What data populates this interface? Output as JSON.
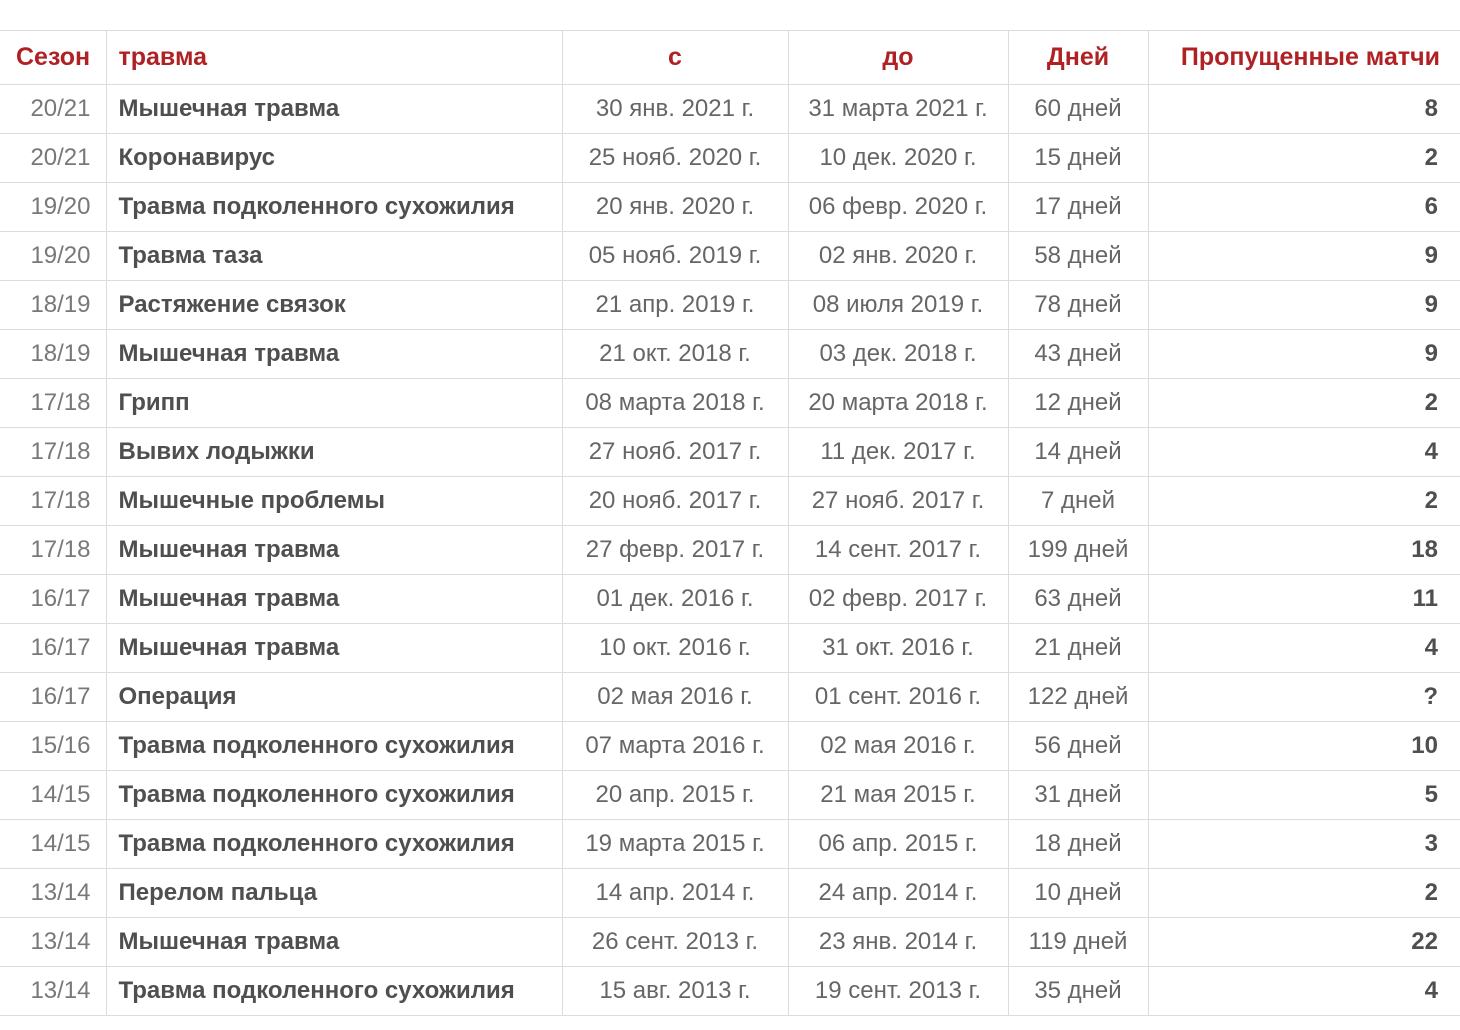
{
  "accent_color": "#b02124",
  "grid_color": "#dcdcdc",
  "chart_data": {
    "type": "table",
    "title": "",
    "columns": [
      "Сезон",
      "травма",
      "с",
      "до",
      "Дней",
      "Пропущенные матчи"
    ],
    "rows": [
      {
        "season": "20/21",
        "injury": "Мышечная травма",
        "from": "30 янв. 2021 г.",
        "to": "31 марта 2021 г.",
        "days": "60 дней",
        "missed": "8"
      },
      {
        "season": "20/21",
        "injury": "Коронавирус",
        "from": "25 нояб. 2020 г.",
        "to": "10 дек. 2020 г.",
        "days": "15 дней",
        "missed": "2"
      },
      {
        "season": "19/20",
        "injury": "Травма подколенного сухожилия",
        "from": "20 янв. 2020 г.",
        "to": "06 февр. 2020 г.",
        "days": "17 дней",
        "missed": "6"
      },
      {
        "season": "19/20",
        "injury": "Травма таза",
        "from": "05 нояб. 2019 г.",
        "to": "02 янв. 2020 г.",
        "days": "58 дней",
        "missed": "9"
      },
      {
        "season": "18/19",
        "injury": "Растяжение связок",
        "from": "21 апр. 2019 г.",
        "to": "08 июля 2019 г.",
        "days": "78 дней",
        "missed": "9"
      },
      {
        "season": "18/19",
        "injury": "Мышечная травма",
        "from": "21 окт. 2018 г.",
        "to": "03 дек. 2018 г.",
        "days": "43 дней",
        "missed": "9"
      },
      {
        "season": "17/18",
        "injury": "Грипп",
        "from": "08 марта 2018 г.",
        "to": "20 марта 2018 г.",
        "days": "12 дней",
        "missed": "2"
      },
      {
        "season": "17/18",
        "injury": "Вывих лодыжки",
        "from": "27 нояб. 2017 г.",
        "to": "11 дек. 2017 г.",
        "days": "14 дней",
        "missed": "4"
      },
      {
        "season": "17/18",
        "injury": "Мышечные проблемы",
        "from": "20 нояб. 2017 г.",
        "to": "27 нояб. 2017 г.",
        "days": "7 дней",
        "missed": "2"
      },
      {
        "season": "17/18",
        "injury": "Мышечная травма",
        "from": "27 февр. 2017 г.",
        "to": "14 сент. 2017 г.",
        "days": "199 дней",
        "missed": "18"
      },
      {
        "season": "16/17",
        "injury": "Мышечная травма",
        "from": "01 дек. 2016 г.",
        "to": "02 февр. 2017 г.",
        "days": "63 дней",
        "missed": "11"
      },
      {
        "season": "16/17",
        "injury": "Мышечная травма",
        "from": "10 окт. 2016 г.",
        "to": "31 окт. 2016 г.",
        "days": "21 дней",
        "missed": "4"
      },
      {
        "season": "16/17",
        "injury": "Операция",
        "from": "02 мая 2016 г.",
        "to": "01 сент. 2016 г.",
        "days": "122 дней",
        "missed": "?"
      },
      {
        "season": "15/16",
        "injury": "Травма подколенного сухожилия",
        "from": "07 марта 2016 г.",
        "to": "02 мая 2016 г.",
        "days": "56 дней",
        "missed": "10"
      },
      {
        "season": "14/15",
        "injury": "Травма подколенного сухожилия",
        "from": "20 апр. 2015 г.",
        "to": "21 мая 2015 г.",
        "days": "31 дней",
        "missed": "5"
      },
      {
        "season": "14/15",
        "injury": "Травма подколенного сухожилия",
        "from": "19 марта 2015 г.",
        "to": "06 апр. 2015 г.",
        "days": "18 дней",
        "missed": "3"
      },
      {
        "season": "13/14",
        "injury": "Перелом пальца",
        "from": "14 апр. 2014 г.",
        "to": "24 апр. 2014 г.",
        "days": "10 дней",
        "missed": "2"
      },
      {
        "season": "13/14",
        "injury": "Мышечная травма",
        "from": "26 сент. 2013 г.",
        "to": "23 янв. 2014 г.",
        "days": "119 дней",
        "missed": "22"
      },
      {
        "season": "13/14",
        "injury": "Травма подколенного сухожилия",
        "from": "15 авг. 2013 г.",
        "to": "19 сент. 2013 г.",
        "days": "35 дней",
        "missed": "4"
      }
    ]
  },
  "header": {
    "season": "Сезон",
    "injury": "травма",
    "from": "с",
    "to": "до",
    "days": "Дней",
    "missed": "Пропущенные матчи"
  }
}
